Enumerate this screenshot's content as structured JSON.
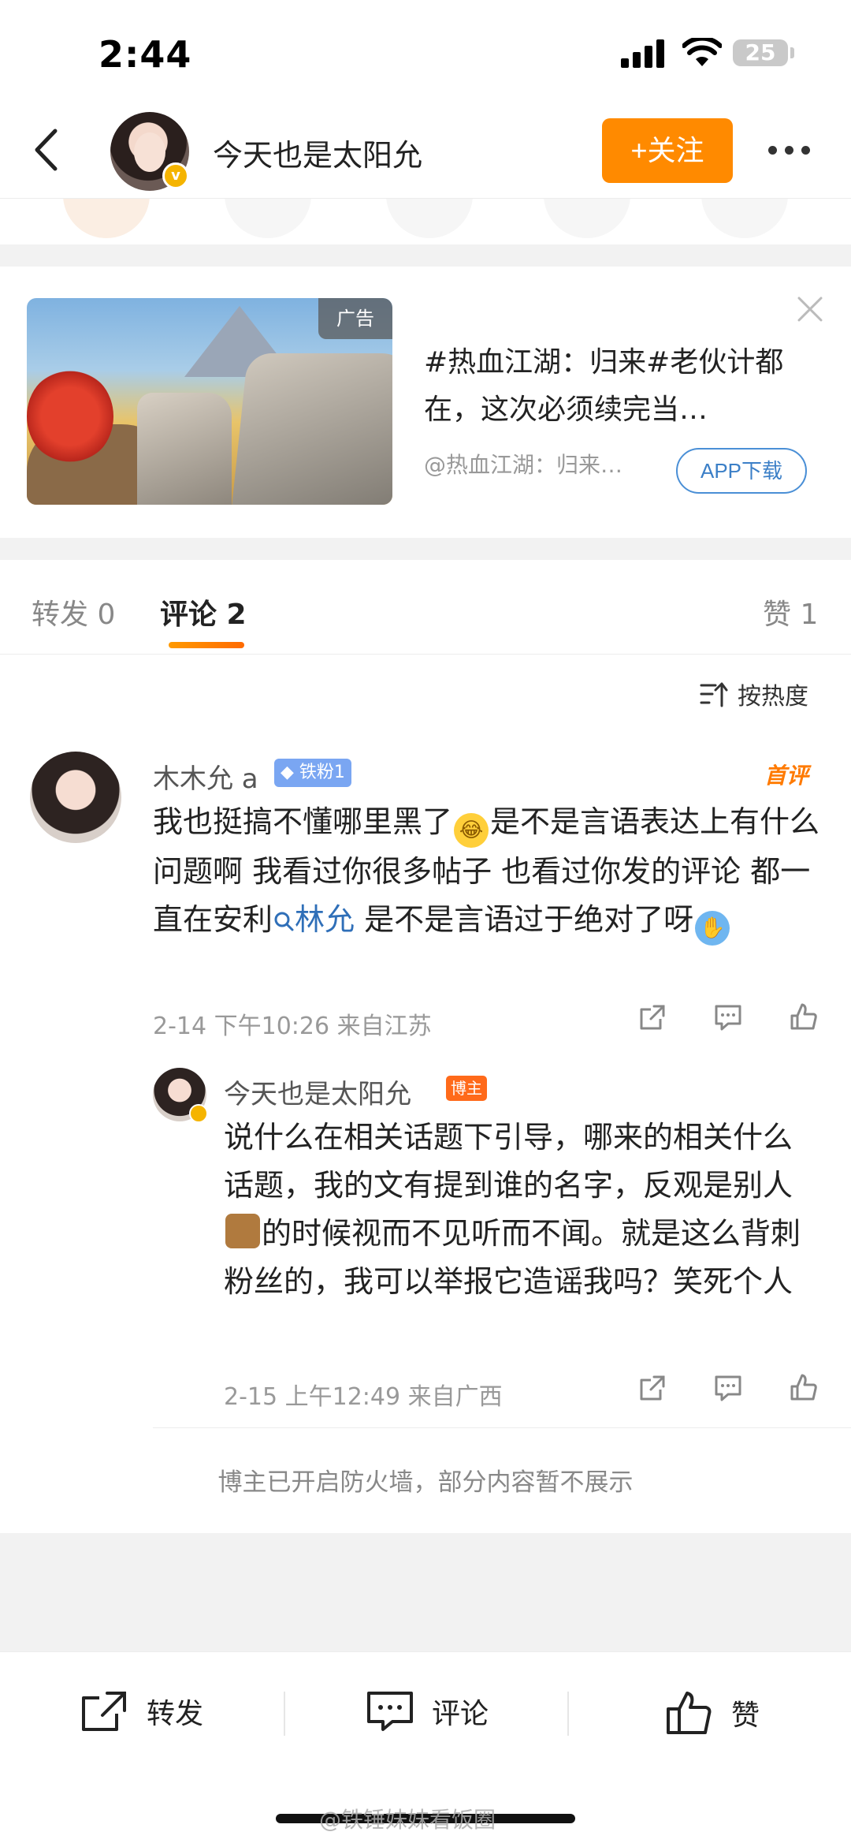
{
  "status_bar": {
    "time": "2:44",
    "battery": "25"
  },
  "nav": {
    "title": "今天也是太阳允",
    "follow_label": "+关注"
  },
  "ad": {
    "tag": "广告",
    "text": "#热血江湖：归来#老伙计都在，这次必须续完当…",
    "source": "@热血江湖：归来…",
    "button": "APP下载"
  },
  "tabs": [
    {
      "label": "转发 0"
    },
    {
      "label": "评论 2"
    },
    {
      "label": "赞 1"
    }
  ],
  "sort_label": "按热度",
  "comments": [
    {
      "name": "木木允 a",
      "badge": "铁粉1",
      "top_label": "首评",
      "text_1": "我也挺搞不懂哪里黑了",
      "text_2": "是不是言语表达上有什么问题啊 我看过你很多帖子 也看过你发的评论 都一直在安利",
      "link": "林允",
      "text_3": " 是不是言语过于绝对了呀",
      "meta": "2-14 下午10:26 来自江苏"
    },
    {
      "name": "今天也是太阳允",
      "badge": "博主",
      "text_1": "说什么在相关话题下引导，哪来的相关什么话题，我的文有提到谁的名字，反观是别人",
      "text_2": "的时候视而不见听而不闻。就是这么背刺粉丝的，我可以举报它造谣我吗？笑死个人",
      "meta": "2-15 上午12:49 来自广西"
    }
  ],
  "firewall_note": "博主已开启防火墙，部分内容暂不展示",
  "bottom_bar": {
    "repost": "转发",
    "comment": "评论",
    "like": "赞"
  },
  "watermark": "@铁锤妹妹看饭圈",
  "colors": {
    "accent": "#ff8a00",
    "link": "#2f6fb8",
    "fan_badge": "#7aa6f2",
    "blogger_badge": "#ff6a1a"
  }
}
